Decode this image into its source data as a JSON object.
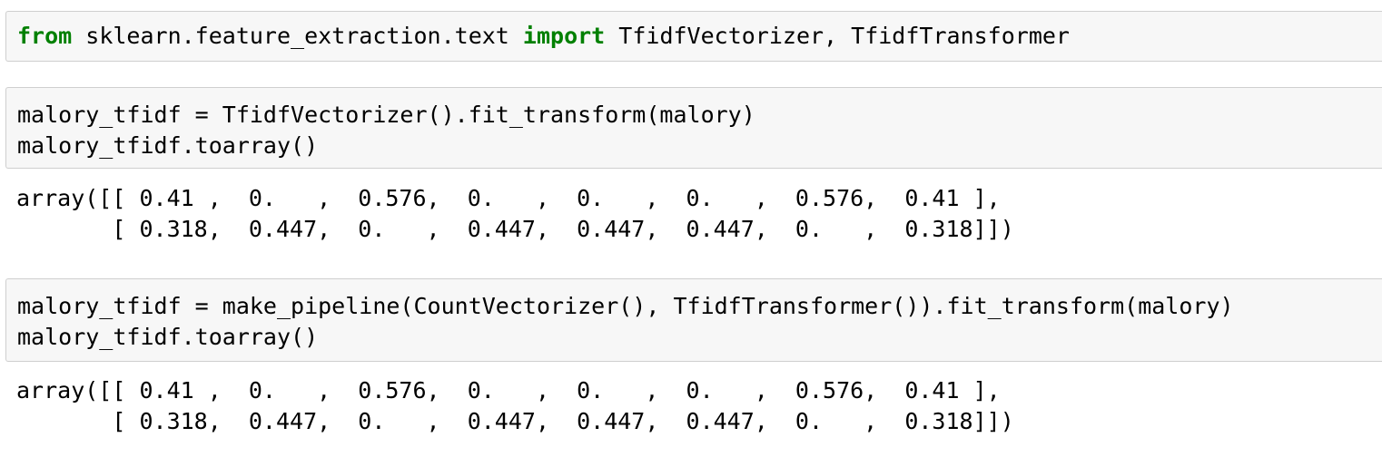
{
  "notebook": {
    "cell1": {
      "kw_from": "from",
      "module": " sklearn.feature_extraction.text ",
      "kw_import": "import",
      "names": " TfidfVectorizer, TfidfTransformer"
    },
    "cell2": {
      "line1": "malory_tfidf = TfidfVectorizer().fit_transform(malory)",
      "line2": "malory_tfidf.toarray()"
    },
    "output2": {
      "line1": "array([[ 0.41 ,  0.   ,  0.576,  0.   ,  0.   ,  0.   ,  0.576,  0.41 ],",
      "line2": "       [ 0.318,  0.447,  0.   ,  0.447,  0.447,  0.447,  0.   ,  0.318]])"
    },
    "cell3": {
      "line1": "malory_tfidf = make_pipeline(CountVectorizer(), TfidfTransformer()).fit_transform(malory)",
      "line2": "malory_tfidf.toarray()"
    },
    "output3": {
      "line1": "array([[ 0.41 ,  0.   ,  0.576,  0.   ,  0.   ,  0.   ,  0.576,  0.41 ],",
      "line2": "       [ 0.318,  0.447,  0.   ,  0.447,  0.447,  0.447,  0.   ,  0.318]])"
    }
  }
}
